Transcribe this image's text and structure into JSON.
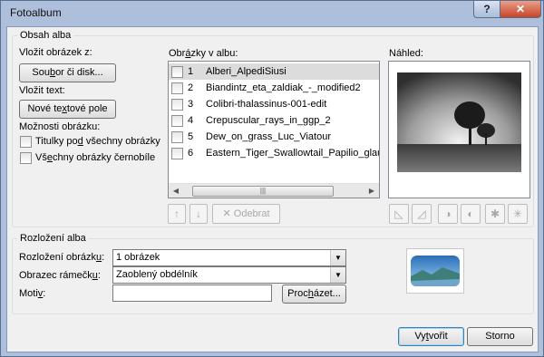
{
  "window": {
    "title": "Fotoalbum",
    "help": "?",
    "close": "✕"
  },
  "content_group": {
    "label": "Obsah alba",
    "insert_from_label": "Vložit obrázek z:",
    "file_button": {
      "pre": "Sou",
      "u": "b",
      "post": "or či disk..."
    },
    "insert_text_label": "Vložit text:",
    "text_box_button": {
      "pre": "Nové te",
      "u": "x",
      "post": "tové pole"
    },
    "options_label": "Možnosti obrázku:",
    "options": [
      {
        "pre": "Titulky po",
        "u": "d",
        "post": " všechny obrázky"
      },
      {
        "pre": "Vš",
        "u": "e",
        "post": "chny obrázky černobíle"
      }
    ],
    "pictures_label": {
      "pre": "Obr",
      "u": "á",
      "post": "zky v albu:"
    },
    "pictures": [
      {
        "num": "1",
        "name": "Alberi_AlpediSiusi"
      },
      {
        "num": "2",
        "name": "Biandintz_eta_zaldiak_-_modified2"
      },
      {
        "num": "3",
        "name": "Colibri-thalassinus-001-edit"
      },
      {
        "num": "4",
        "name": "Crepuscular_rays_in_ggp_2"
      },
      {
        "num": "5",
        "name": "Dew_on_grass_Luc_Viatour"
      },
      {
        "num": "6",
        "name": "Eastern_Tiger_Swallowtail_Papilio_glauc"
      }
    ],
    "remove_button": "Odebrat",
    "preview_label": "Náhled:"
  },
  "layout_group": {
    "label": "Rozložení alba",
    "picture_layout": {
      "label_pre": "Rozložení obrázk",
      "label_u": "u",
      "label_post": ":",
      "value": "1 obrázek"
    },
    "frame_shape": {
      "label_pre": "Obrazec rámečk",
      "label_u": "u",
      "label_post": ":",
      "value": "Zaoblený obdélník"
    },
    "theme": {
      "label_pre": "Moti",
      "label_u": "v",
      "label_post": ":",
      "value": ""
    },
    "browse_button": {
      "pre": "Proc",
      "u": "h",
      "post": "ázet..."
    }
  },
  "footer": {
    "create_button": {
      "pre": "Vy",
      "u": "t",
      "post": "vořit"
    },
    "cancel_button": "Storno"
  }
}
